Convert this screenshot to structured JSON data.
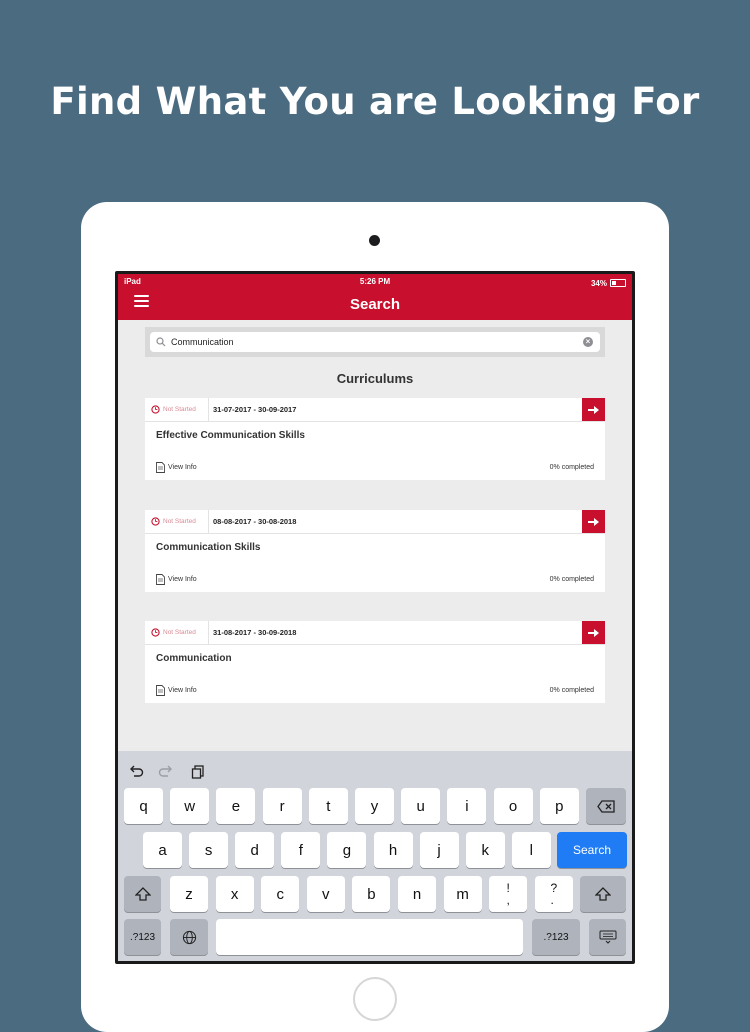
{
  "headline": "Find What You are Looking For",
  "status_bar": {
    "device": "iPad",
    "time": "5:26 PM",
    "battery": "34%"
  },
  "nav": {
    "title": "Search",
    "menu_icon": "hamburger-menu-icon"
  },
  "search": {
    "value": "Communication",
    "placeholder": ""
  },
  "section_title": "Curriculums",
  "curriculums": [
    {
      "status": "Not Started",
      "dates": "31-07-2017 - 30-09-2017",
      "title": "Effective Communication Skills",
      "view_info": "View Info",
      "progress": "0% completed"
    },
    {
      "status": "Not Started",
      "dates": "08-08-2017 - 30-08-2018",
      "title": "Communication Skills",
      "view_info": "View Info",
      "progress": "0% completed"
    },
    {
      "status": "Not Started",
      "dates": "31-08-2017 - 30-09-2018",
      "title": "Communication",
      "view_info": "View Info",
      "progress": "0% completed"
    }
  ],
  "keyboard": {
    "row1": [
      "q",
      "w",
      "e",
      "r",
      "t",
      "y",
      "u",
      "i",
      "o",
      "p"
    ],
    "row2": [
      "a",
      "s",
      "d",
      "f",
      "g",
      "h",
      "j",
      "k",
      "l"
    ],
    "row3": [
      "z",
      "x",
      "c",
      "v",
      "b",
      "n",
      "m",
      "!\n,",
      "?\n."
    ],
    "search_label": "Search",
    "numbers_label": ".?123"
  },
  "colors": {
    "accent": "#c8102e",
    "background": "#4a6b80",
    "search_key": "#1f7cf5"
  }
}
